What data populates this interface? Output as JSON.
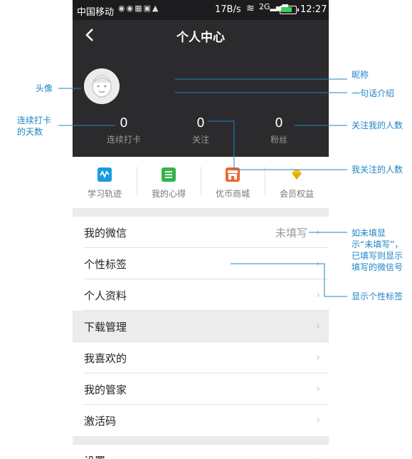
{
  "status_bar": {
    "carrier": "中国移动",
    "speed": "17B/s",
    "network": "2G",
    "time": "12:27",
    "battery_level": 0.8
  },
  "header": {
    "title": "个人中心",
    "stats": [
      {
        "value": "0",
        "label": "连续打卡"
      },
      {
        "value": "0",
        "label": "关注"
      },
      {
        "value": "0",
        "label": "粉丝"
      }
    ]
  },
  "quick_menu": [
    {
      "label": "学习轨迹",
      "icon": "wave-icon",
      "color": "#1a9be0"
    },
    {
      "label": "我的心得",
      "icon": "note-icon",
      "color": "#35b24a"
    },
    {
      "label": "优币商城",
      "icon": "shop-icon",
      "color": "#f0642a"
    },
    {
      "label": "会员权益",
      "icon": "diamond-icon",
      "color": "#f5c518"
    }
  ],
  "list": [
    {
      "label": "我的微信",
      "value": "未填写"
    },
    {
      "label": "个性标签"
    },
    {
      "label": "个人资料"
    },
    {
      "label": "下载管理"
    },
    {
      "label": "我喜欢的"
    },
    {
      "label": "我的管家"
    },
    {
      "label": "激活码"
    },
    {
      "label": "设置"
    }
  ],
  "annotations": {
    "avatar": "头像",
    "streak_line1": "连续打卡",
    "streak_line2": "的天数",
    "nickname": "昵称",
    "bio": "一句话介绍",
    "followers": "关注我的人数",
    "following": "我关注的人数",
    "wechat_line1": "如未填显",
    "wechat_line2": "示“未填写”，",
    "wechat_line3": "已填写则显示",
    "wechat_line4": "填写的微信号",
    "tags": "显示个性标签"
  },
  "colors": {
    "header_bg": "#2b2b2d",
    "annotation": "#1f84c6"
  }
}
